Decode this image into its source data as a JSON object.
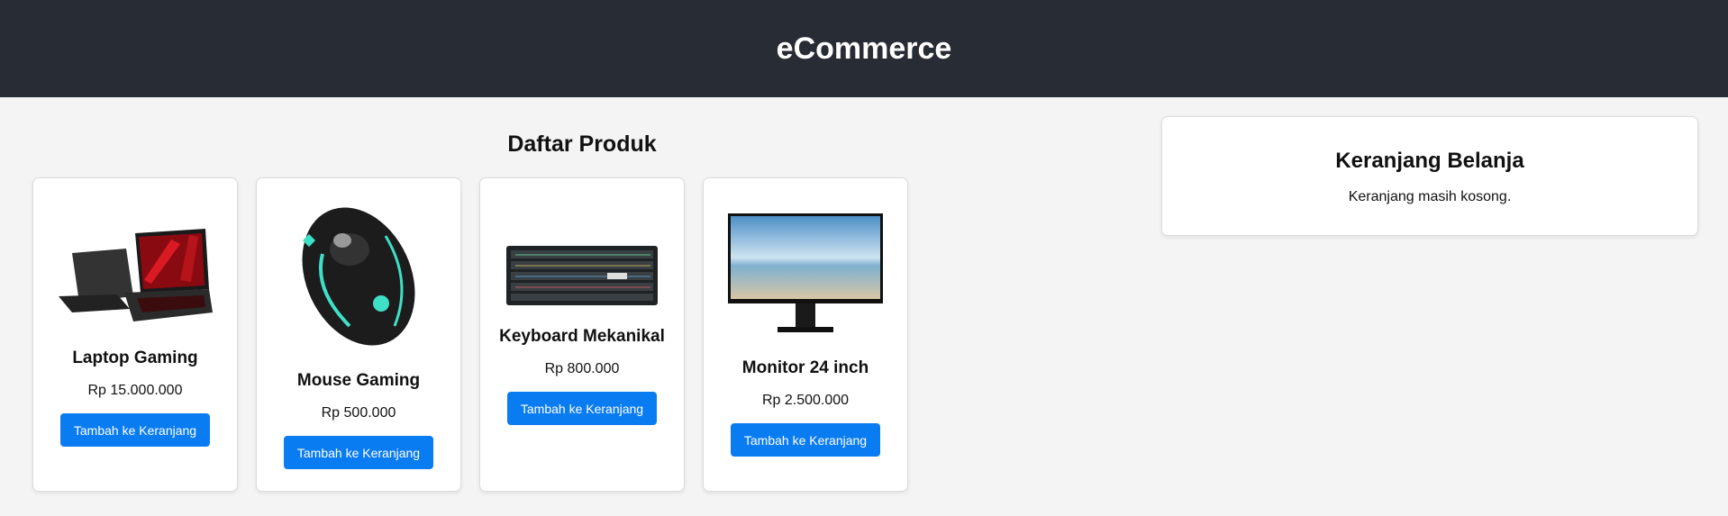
{
  "header": {
    "title": "eCommerce"
  },
  "products": {
    "title": "Daftar Produk",
    "items": [
      {
        "name": "Laptop Gaming",
        "price": "Rp 15.000.000",
        "button": "Tambah ke Keranjang",
        "icon": "laptop-image"
      },
      {
        "name": "Mouse Gaming",
        "price": "Rp 500.000",
        "button": "Tambah ke Keranjang",
        "icon": "mouse-image"
      },
      {
        "name": "Keyboard Mekanikal",
        "price": "Rp 800.000",
        "button": "Tambah ke Keranjang",
        "icon": "keyboard-image"
      },
      {
        "name": "Monitor 24 inch",
        "price": "Rp 2.500.000",
        "button": "Tambah ke Keranjang",
        "icon": "monitor-image"
      }
    ]
  },
  "cart": {
    "title": "Keranjang Belanja",
    "empty_text": "Keranjang masih kosong."
  },
  "colors": {
    "header_bg": "#282c34",
    "button": "#0a7cf1",
    "page_bg": "#f4f4f4"
  }
}
